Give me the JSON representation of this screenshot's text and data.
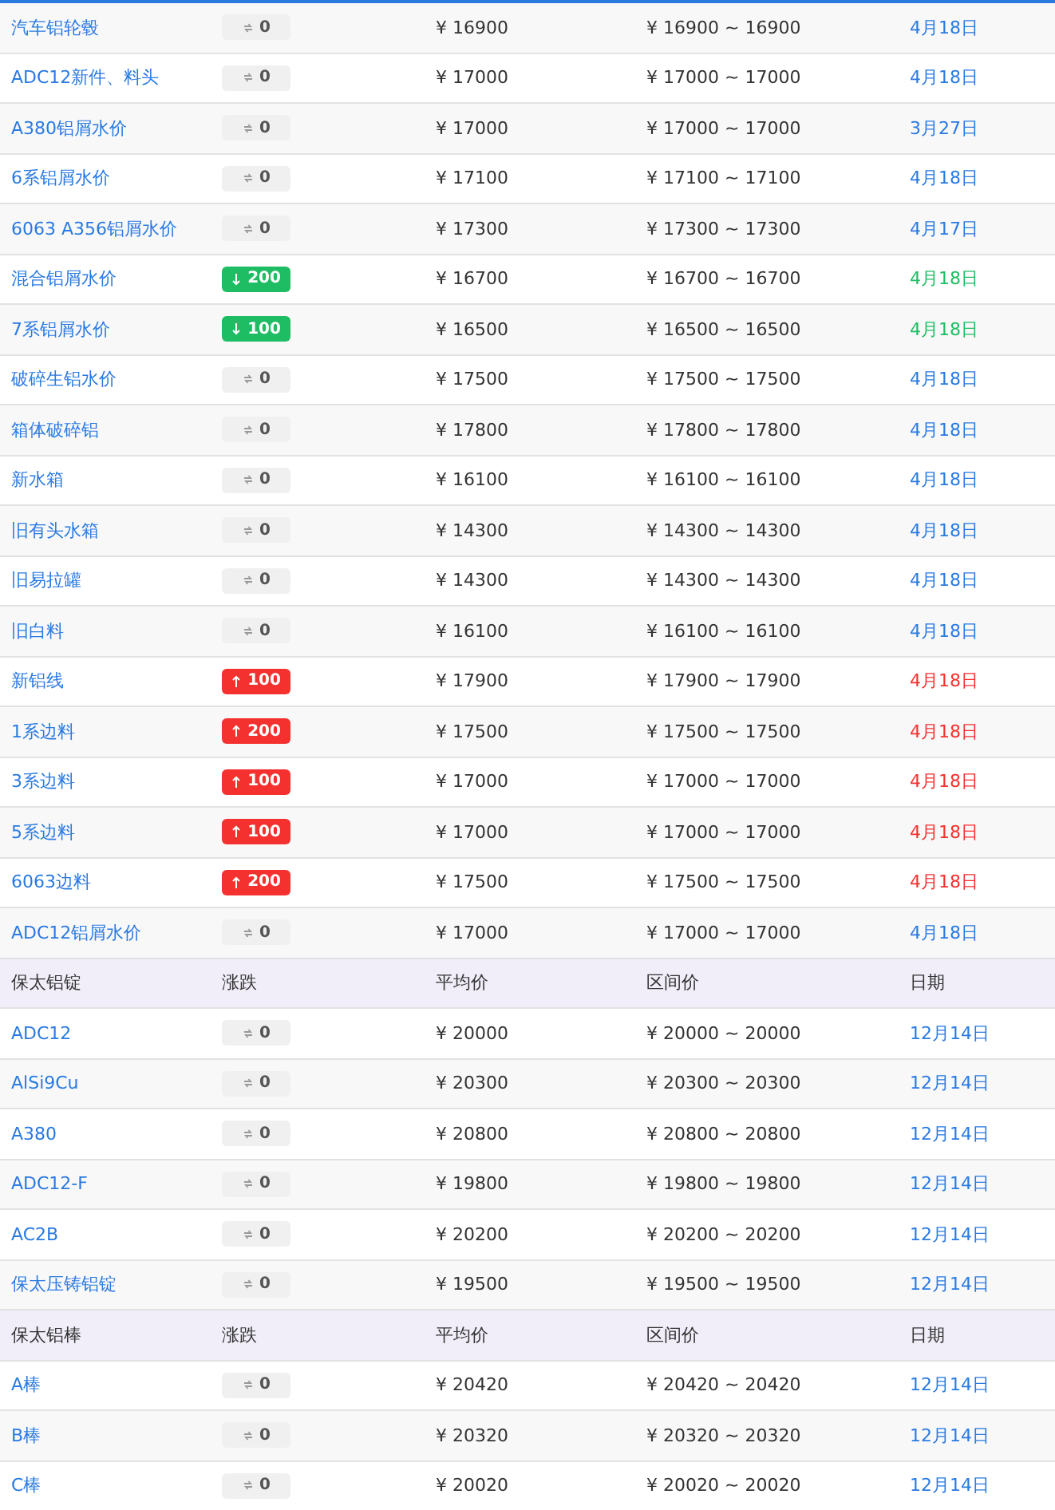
{
  "sections": [
    {
      "rows": [
        {
          "name": "汽车铝轮毂",
          "change": {
            "kind": "flat",
            "value": "0"
          },
          "avg": "¥ 16900",
          "range": "¥ 16900 ~ 16900",
          "date": "4月18日"
        },
        {
          "name": "ADC12新件、料头",
          "change": {
            "kind": "flat",
            "value": "0"
          },
          "avg": "¥ 17000",
          "range": "¥ 17000 ~ 17000",
          "date": "4月18日"
        },
        {
          "name": "A380铝屑水价",
          "change": {
            "kind": "flat",
            "value": "0"
          },
          "avg": "¥ 17000",
          "range": "¥ 17000 ~ 17000",
          "date": "3月27日"
        },
        {
          "name": "6系铝屑水价",
          "change": {
            "kind": "flat",
            "value": "0"
          },
          "avg": "¥ 17100",
          "range": "¥ 17100 ~ 17100",
          "date": "4月18日"
        },
        {
          "name": "6063 A356铝屑水价",
          "change": {
            "kind": "flat",
            "value": "0"
          },
          "avg": "¥ 17300",
          "range": "¥ 17300 ~ 17300",
          "date": "4月17日"
        },
        {
          "name": "混合铝屑水价",
          "change": {
            "kind": "down",
            "value": "200"
          },
          "avg": "¥ 16700",
          "range": "¥ 16700 ~ 16700",
          "date": "4月18日"
        },
        {
          "name": "7系铝屑水价",
          "change": {
            "kind": "down",
            "value": "100"
          },
          "avg": "¥ 16500",
          "range": "¥ 16500 ~ 16500",
          "date": "4月18日"
        },
        {
          "name": "破碎生铝水价",
          "change": {
            "kind": "flat",
            "value": "0"
          },
          "avg": "¥ 17500",
          "range": "¥ 17500 ~ 17500",
          "date": "4月18日"
        },
        {
          "name": "箱体破碎铝",
          "change": {
            "kind": "flat",
            "value": "0"
          },
          "avg": "¥ 17800",
          "range": "¥ 17800 ~ 17800",
          "date": "4月18日"
        },
        {
          "name": "新水箱",
          "change": {
            "kind": "flat",
            "value": "0"
          },
          "avg": "¥ 16100",
          "range": "¥ 16100 ~ 16100",
          "date": "4月18日"
        },
        {
          "name": "旧有头水箱",
          "change": {
            "kind": "flat",
            "value": "0"
          },
          "avg": "¥ 14300",
          "range": "¥ 14300 ~ 14300",
          "date": "4月18日"
        },
        {
          "name": "旧易拉罐",
          "change": {
            "kind": "flat",
            "value": "0"
          },
          "avg": "¥ 14300",
          "range": "¥ 14300 ~ 14300",
          "date": "4月18日"
        },
        {
          "name": "旧白料",
          "change": {
            "kind": "flat",
            "value": "0"
          },
          "avg": "¥ 16100",
          "range": "¥ 16100 ~ 16100",
          "date": "4月18日"
        },
        {
          "name": "新铝线",
          "change": {
            "kind": "up",
            "value": "100"
          },
          "avg": "¥ 17900",
          "range": "¥ 17900 ~ 17900",
          "date": "4月18日"
        },
        {
          "name": "1系边料",
          "change": {
            "kind": "up",
            "value": "200"
          },
          "avg": "¥ 17500",
          "range": "¥ 17500 ~ 17500",
          "date": "4月18日"
        },
        {
          "name": "3系边料",
          "change": {
            "kind": "up",
            "value": "100"
          },
          "avg": "¥ 17000",
          "range": "¥ 17000 ~ 17000",
          "date": "4月18日"
        },
        {
          "name": "5系边料",
          "change": {
            "kind": "up",
            "value": "100"
          },
          "avg": "¥ 17000",
          "range": "¥ 17000 ~ 17000",
          "date": "4月18日"
        },
        {
          "name": "6063边料",
          "change": {
            "kind": "up",
            "value": "200"
          },
          "avg": "¥ 17500",
          "range": "¥ 17500 ~ 17500",
          "date": "4月18日"
        },
        {
          "name": "ADC12铝屑水价",
          "change": {
            "kind": "flat",
            "value": "0"
          },
          "avg": "¥ 17000",
          "range": "¥ 17000 ~ 17000",
          "date": "4月18日"
        }
      ]
    },
    {
      "header": [
        "保太铝锭",
        "涨跌",
        "平均价",
        "区间价",
        "日期"
      ],
      "rows": [
        {
          "name": "ADC12",
          "change": {
            "kind": "flat",
            "value": "0"
          },
          "avg": "¥ 20000",
          "range": "¥ 20000 ~ 20000",
          "date": "12月14日"
        },
        {
          "name": "AlSi9Cu",
          "change": {
            "kind": "flat",
            "value": "0"
          },
          "avg": "¥ 20300",
          "range": "¥ 20300 ~ 20300",
          "date": "12月14日"
        },
        {
          "name": "A380",
          "change": {
            "kind": "flat",
            "value": "0"
          },
          "avg": "¥ 20800",
          "range": "¥ 20800 ~ 20800",
          "date": "12月14日"
        },
        {
          "name": "ADC12-F",
          "change": {
            "kind": "flat",
            "value": "0"
          },
          "avg": "¥ 19800",
          "range": "¥ 19800 ~ 19800",
          "date": "12月14日"
        },
        {
          "name": "AC2B",
          "change": {
            "kind": "flat",
            "value": "0"
          },
          "avg": "¥ 20200",
          "range": "¥ 20200 ~ 20200",
          "date": "12月14日"
        },
        {
          "name": "保太压铸铝锭",
          "change": {
            "kind": "flat",
            "value": "0"
          },
          "avg": "¥ 19500",
          "range": "¥ 19500 ~ 19500",
          "date": "12月14日"
        }
      ]
    },
    {
      "header": [
        "保太铝棒",
        "涨跌",
        "平均价",
        "区间价",
        "日期"
      ],
      "rows": [
        {
          "name": "A棒",
          "change": {
            "kind": "flat",
            "value": "0"
          },
          "avg": "¥ 20420",
          "range": "¥ 20420 ~ 20420",
          "date": "12月14日"
        },
        {
          "name": "B棒",
          "change": {
            "kind": "flat",
            "value": "0"
          },
          "avg": "¥ 20320",
          "range": "¥ 20320 ~ 20320",
          "date": "12月14日"
        },
        {
          "name": "C棒",
          "change": {
            "kind": "flat",
            "value": "0"
          },
          "avg": "¥ 20020",
          "range": "¥ 20020 ~ 20020",
          "date": "12月14日"
        }
      ]
    }
  ]
}
